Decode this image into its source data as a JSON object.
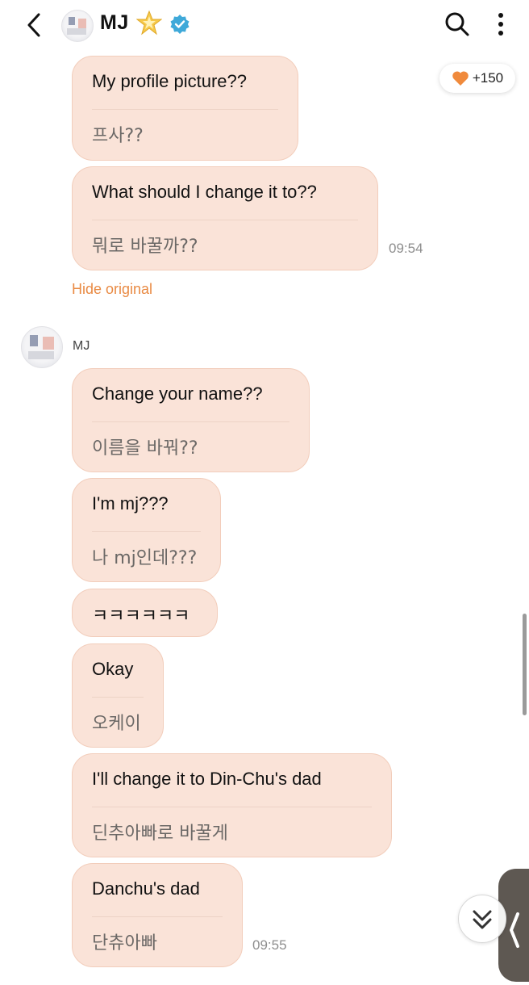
{
  "header": {
    "title": "MJ",
    "star_icon": "star-badge-icon",
    "verified_icon": "verified-badge-icon"
  },
  "likes": {
    "count": "+150",
    "icon": "heart-icon",
    "color": "#f08a3c"
  },
  "messages_top": [
    {
      "text": "My profile picture??",
      "original": "프사??"
    },
    {
      "text": "What should I change it to??",
      "original": "뭐로 바꿀까??",
      "time": "09:54"
    }
  ],
  "hide_original": "Hide original",
  "sender": {
    "name": "MJ"
  },
  "messages_bottom": [
    {
      "text": "Change your name??",
      "original": "이름을 바꿔??"
    },
    {
      "text": "I'm mj???",
      "original": "나 mj인데???"
    },
    {
      "text": "ㅋㅋㅋㅋㅋㅋ"
    },
    {
      "text": "Okay",
      "original": "오케이"
    },
    {
      "text": "I'll change it to Din-Chu's dad",
      "original": "딘추아빠로 바꿀게"
    },
    {
      "text": "Danchu's dad",
      "original": "단츄아빠",
      "time": "09:55"
    }
  ],
  "colors": {
    "bubble": "#fae3d8",
    "accent": "#e98a43"
  }
}
